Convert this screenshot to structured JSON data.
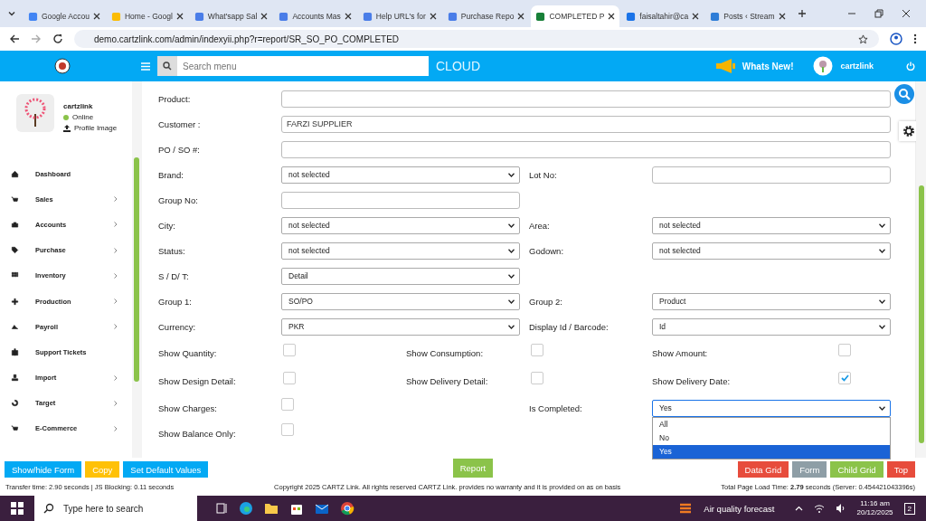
{
  "browser": {
    "tabs": [
      {
        "title": "Google Accou",
        "selected": false
      },
      {
        "title": "Home - Googl",
        "selected": false
      },
      {
        "title": "What'sapp Sal",
        "selected": false
      },
      {
        "title": "Accounts Mas",
        "selected": false
      },
      {
        "title": "Help URL's for",
        "selected": false
      },
      {
        "title": "Purchase Repo",
        "selected": false
      },
      {
        "title": "COMPLETED P",
        "selected": true
      },
      {
        "title": "faisaltahir@ca",
        "selected": false
      },
      {
        "title": "Posts ‹ Stream",
        "selected": false
      }
    ],
    "url": "demo.cartzlink.com/admin/indexyii.php?r=report/SR_SO_PO_COMPLETED"
  },
  "header": {
    "search_placeholder": "Search menu",
    "brand": "CLOUD",
    "whats_new": "Whats New!",
    "user": "cartzlink"
  },
  "sidebar": {
    "user": "cartzlink",
    "status": "Online",
    "profile_link": "Profile Image",
    "items": [
      {
        "label": "Dashboard",
        "expandable": false
      },
      {
        "label": "Sales",
        "expandable": true
      },
      {
        "label": "Accounts",
        "expandable": true
      },
      {
        "label": "Purchase",
        "expandable": true
      },
      {
        "label": "Inventory",
        "expandable": true
      },
      {
        "label": "Production",
        "expandable": true
      },
      {
        "label": "Payroll",
        "expandable": true
      },
      {
        "label": "Support Tickets",
        "expandable": false
      },
      {
        "label": "Import",
        "expandable": true
      },
      {
        "label": "Target",
        "expandable": true
      },
      {
        "label": "E-Commerce",
        "expandable": true
      }
    ]
  },
  "form": {
    "rows": [
      {
        "kind": "full",
        "cells": [
          {
            "label": "Product:",
            "kind": "text"
          }
        ]
      },
      {
        "kind": "full",
        "cells": [
          {
            "label": "Customer :",
            "kind": "text",
            "value": "FARZI SUPPLIER"
          }
        ]
      },
      {
        "kind": "full",
        "cells": [
          {
            "label": "PO / SO #:",
            "kind": "text"
          }
        ]
      },
      {
        "kind": "pair",
        "cells": [
          {
            "label": "Brand:",
            "kind": "select",
            "value": "not selected"
          },
          {
            "label": "Lot No:",
            "kind": "text"
          }
        ]
      },
      {
        "kind": "pair",
        "cells": [
          {
            "label": "Group No:",
            "kind": "text"
          }
        ]
      },
      {
        "kind": "pair",
        "cells": [
          {
            "label": "City:",
            "kind": "select",
            "value": "not selected"
          },
          {
            "label": "Area:",
            "kind": "select",
            "value": "not selected"
          }
        ]
      },
      {
        "kind": "pair",
        "cells": [
          {
            "label": "Status:",
            "kind": "select",
            "value": "not selected"
          },
          {
            "label": "Godown:",
            "kind": "select",
            "value": "not selected"
          }
        ]
      },
      {
        "kind": "pair",
        "cells": [
          {
            "label": "S / D/ T:",
            "kind": "select",
            "value": "Detail"
          }
        ]
      },
      {
        "kind": "pair",
        "cells": [
          {
            "label": "Group 1:",
            "kind": "select",
            "value": "SO/PO"
          },
          {
            "label": "Group 2:",
            "kind": "select",
            "value": "Product"
          }
        ]
      },
      {
        "kind": "pair",
        "cells": [
          {
            "label": "Currency:",
            "kind": "select",
            "value": "PKR"
          },
          {
            "label": "Display Id / Barcode:",
            "kind": "select",
            "value": "Id"
          }
        ]
      },
      {
        "kind": "checks",
        "cells": [
          {
            "label": "Show Quantity:",
            "kind": "checkbox",
            "checked": false
          },
          {
            "label": "Show Consumption:",
            "kind": "checkbox",
            "checked": false
          },
          {
            "label": "Show Amount:",
            "kind": "checkbox",
            "checked": false
          }
        ]
      },
      {
        "kind": "checks",
        "cells": [
          {
            "label": "Show Design Detail:",
            "kind": "checkbox",
            "checked": false
          },
          {
            "label": "Show Delivery Detail:",
            "kind": "checkbox",
            "checked": false
          },
          {
            "label": "Show Delivery Date:",
            "kind": "checkbox",
            "checked": true
          }
        ]
      },
      {
        "kind": "pair",
        "cells": [
          {
            "label": "Show Charges:",
            "kind": "checkbox",
            "checked": false
          },
          {
            "label": "Is Completed:",
            "kind": "select",
            "value": "Yes",
            "expanded": true,
            "options": [
              {
                "label": "All",
                "selected": false
              },
              {
                "label": "No",
                "selected": false
              },
              {
                "label": "Yes",
                "selected": true
              }
            ]
          }
        ]
      },
      {
        "kind": "pair",
        "cells": [
          {
            "label": "Show Balance Only:",
            "kind": "checkbox",
            "checked": false
          }
        ]
      }
    ]
  },
  "buttons": {
    "left": [
      {
        "label": "Show/hide Form",
        "color": "#03a9f4"
      },
      {
        "label": "Copy",
        "color": "#ffc107"
      },
      {
        "label": "Set Default Values",
        "color": "#03a9f4"
      }
    ],
    "center": [
      {
        "label": "Report",
        "color": "#8bc34a"
      }
    ],
    "right": [
      {
        "label": "Data Grid",
        "color": "#e74c3c"
      },
      {
        "label": "Form",
        "color": "#8e9ea6"
      },
      {
        "label": "Child Grid",
        "color": "#8bc34a"
      },
      {
        "label": "Top",
        "color": "#e74c3c"
      }
    ]
  },
  "status_bar": {
    "left": "Transfer time: 2.90 seconds | JS Blocking: 0.11 seconds",
    "center": "Copyright 2025 CARTZ Link. All rights reserved CARTZ Link. provides no warranty and it is provided on as on basis",
    "right": "Total Page Load Time: **2.79** seconds (Server: 0.454421043396s)"
  },
  "taskbar": {
    "search_placeholder": "Type here to search",
    "weather": "Air quality forecast",
    "time": "11:16 am",
    "date": "20/12/2025",
    "notifications": "2"
  }
}
